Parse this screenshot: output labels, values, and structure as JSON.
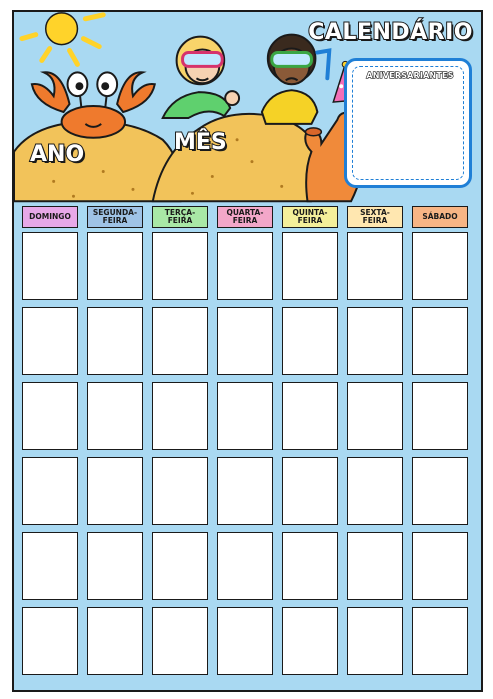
{
  "title": "CALENDÁRIO",
  "labels": {
    "year": "ANO",
    "month": "MÊS"
  },
  "birthdays": {
    "title": "ANIVERSARIANTES"
  },
  "weekdays": [
    {
      "label": "DOMINGO",
      "color": "#e7a8e8"
    },
    {
      "label": "SEGUNDA-\nFEIRA",
      "color": "#9fc3e6"
    },
    {
      "label": "TERÇA-\nFEIRA",
      "color": "#a9e8a6"
    },
    {
      "label": "QUARTA-\nFEIRA",
      "color": "#f3a7c9"
    },
    {
      "label": "QUINTA-\nFEIRA",
      "color": "#f4ef9a"
    },
    {
      "label": "SEXTA-\nFEIRA",
      "color": "#ffe7b0"
    },
    {
      "label": "SÁBADO",
      "color": "#f7b585"
    }
  ],
  "grid": {
    "rows": 6,
    "cols": 7
  },
  "colors": {
    "background": "#a9d9f2",
    "sand": "#f2c35a",
    "crab": "#ef7a2d",
    "coral": "#f08a3a",
    "sun": "#ffd32a",
    "birthday_border": "#1f7fd6"
  }
}
